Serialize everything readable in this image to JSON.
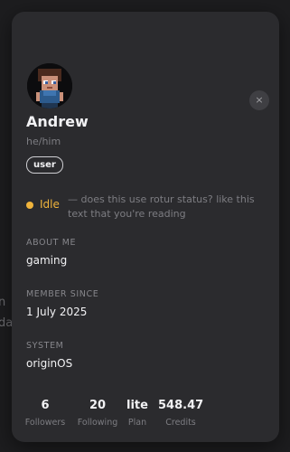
{
  "background": {
    "line1": "n",
    "line2": "da"
  },
  "profile": {
    "name": "Andrew",
    "pronouns": "he/him",
    "badge": "user",
    "close_icon": "×",
    "status": {
      "label": "Idle",
      "color": "#f0b43c",
      "text": "— does this use rotur status? like this text that you're reading"
    },
    "sections": [
      {
        "label": "ABOUT ME",
        "value": "gaming"
      },
      {
        "label": "MEMBER SINCE",
        "value": "1 July 2025"
      },
      {
        "label": "SYSTEM",
        "value": "originOS"
      }
    ],
    "stats": [
      {
        "value": "6",
        "label": "Followers"
      },
      {
        "value": "20",
        "label": "Following"
      },
      {
        "value": "lite",
        "label": "Plan"
      },
      {
        "value": "548.47",
        "label": "Credits"
      }
    ]
  },
  "colors": {
    "card_bg": "#2b2b2e",
    "accent_idle": "#f0b43c"
  }
}
